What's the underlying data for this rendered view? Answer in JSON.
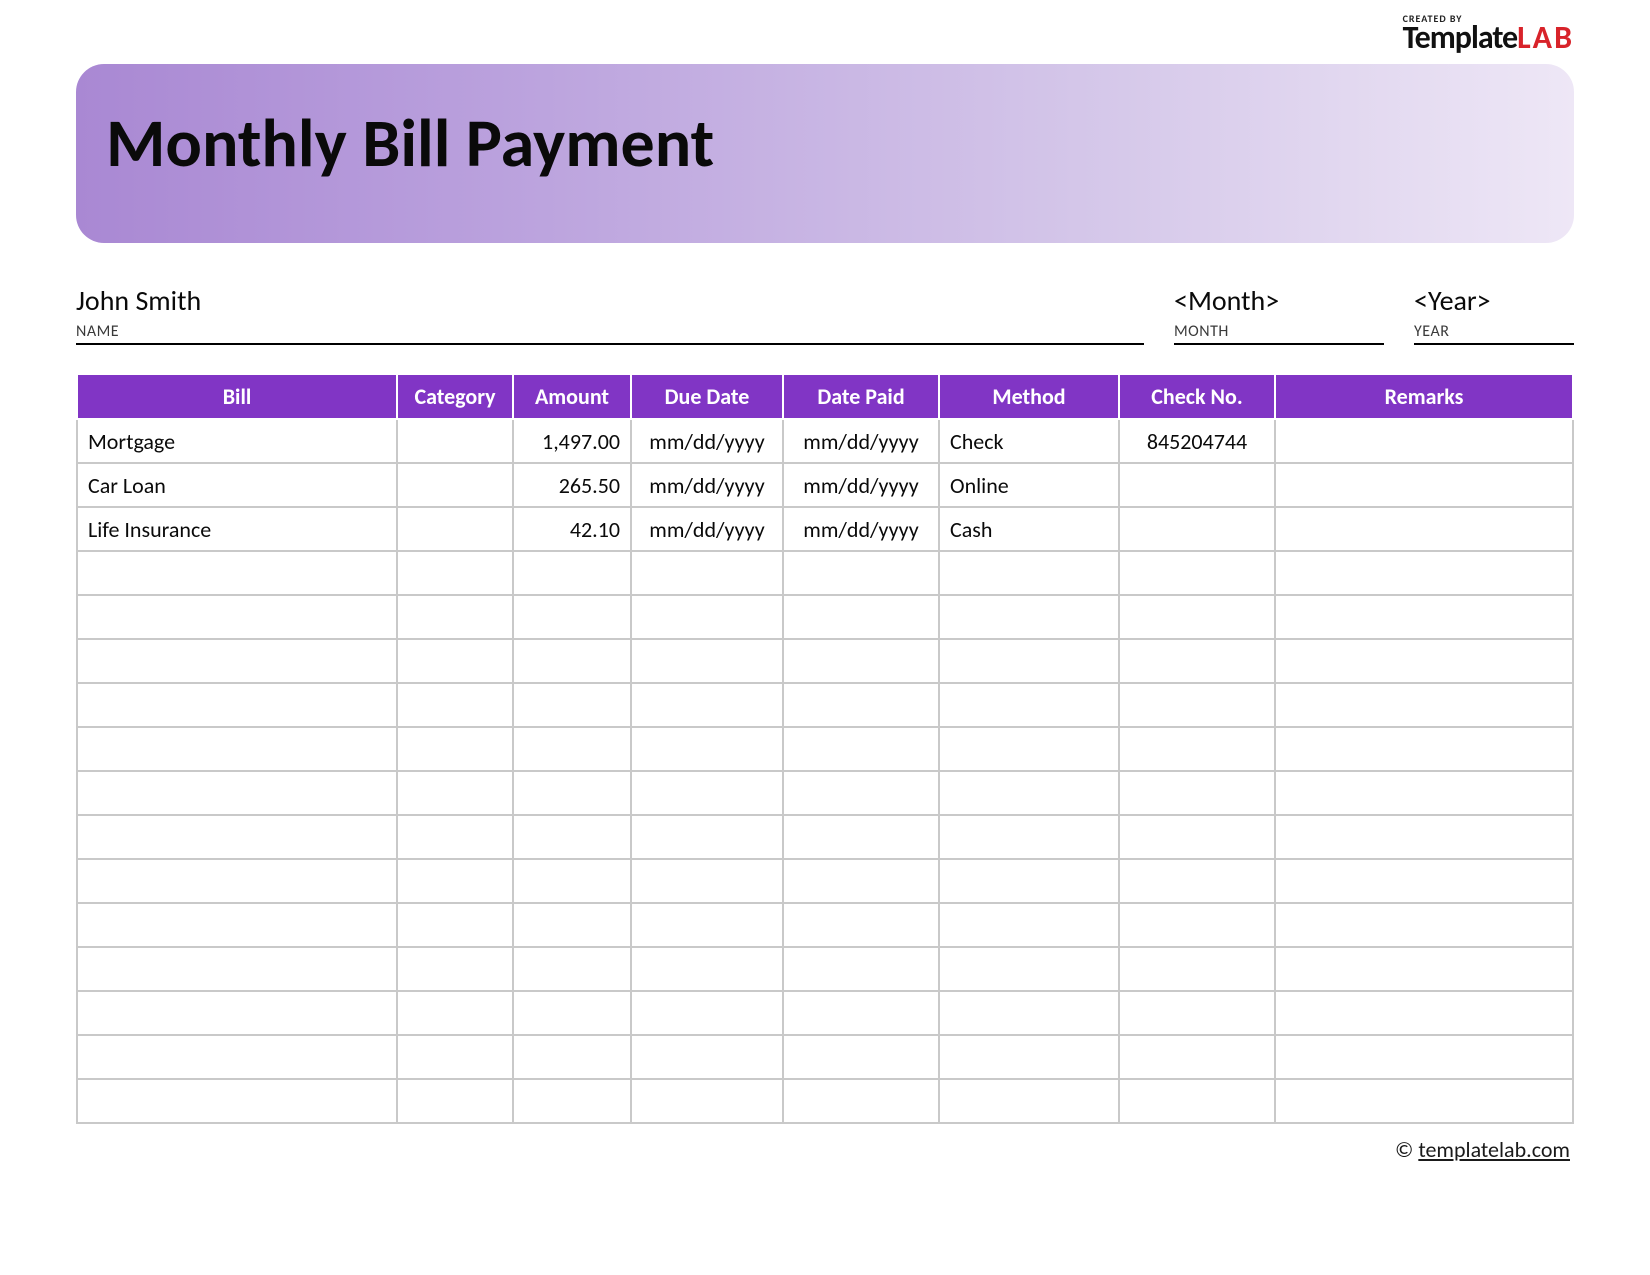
{
  "logo": {
    "created_by": "CREATED BY",
    "brand_part1": "Template",
    "brand_part2": "LAB"
  },
  "hero": {
    "title": "Monthly Bill Payment"
  },
  "meta": {
    "name_value": "John Smith",
    "name_label": "NAME",
    "month_value": "<Month>",
    "month_label": "MONTH",
    "year_value": "<Year>",
    "year_label": "YEAR"
  },
  "columns": {
    "bill": "Bill",
    "category": "Category",
    "amount": "Amount",
    "due": "Due Date",
    "paid": "Date Paid",
    "method": "Method",
    "check": "Check No.",
    "remarks": "Remarks"
  },
  "rows": [
    {
      "bill": "Mortgage",
      "category": "",
      "amount": "1,497.00",
      "due": "mm/dd/yyyy",
      "paid": "mm/dd/yyyy",
      "method": "Check",
      "check": "845204744",
      "remarks": ""
    },
    {
      "bill": "Car Loan",
      "category": "",
      "amount": "265.50",
      "due": "mm/dd/yyyy",
      "paid": "mm/dd/yyyy",
      "method": "Online",
      "check": "",
      "remarks": ""
    },
    {
      "bill": "Life Insurance",
      "category": "",
      "amount": "42.10",
      "due": "mm/dd/yyyy",
      "paid": "mm/dd/yyyy",
      "method": "Cash",
      "check": "",
      "remarks": ""
    },
    {
      "bill": "",
      "category": "",
      "amount": "",
      "due": "",
      "paid": "",
      "method": "",
      "check": "",
      "remarks": ""
    },
    {
      "bill": "",
      "category": "",
      "amount": "",
      "due": "",
      "paid": "",
      "method": "",
      "check": "",
      "remarks": ""
    },
    {
      "bill": "",
      "category": "",
      "amount": "",
      "due": "",
      "paid": "",
      "method": "",
      "check": "",
      "remarks": ""
    },
    {
      "bill": "",
      "category": "",
      "amount": "",
      "due": "",
      "paid": "",
      "method": "",
      "check": "",
      "remarks": ""
    },
    {
      "bill": "",
      "category": "",
      "amount": "",
      "due": "",
      "paid": "",
      "method": "",
      "check": "",
      "remarks": ""
    },
    {
      "bill": "",
      "category": "",
      "amount": "",
      "due": "",
      "paid": "",
      "method": "",
      "check": "",
      "remarks": ""
    },
    {
      "bill": "",
      "category": "",
      "amount": "",
      "due": "",
      "paid": "",
      "method": "",
      "check": "",
      "remarks": ""
    },
    {
      "bill": "",
      "category": "",
      "amount": "",
      "due": "",
      "paid": "",
      "method": "",
      "check": "",
      "remarks": ""
    },
    {
      "bill": "",
      "category": "",
      "amount": "",
      "due": "",
      "paid": "",
      "method": "",
      "check": "",
      "remarks": ""
    },
    {
      "bill": "",
      "category": "",
      "amount": "",
      "due": "",
      "paid": "",
      "method": "",
      "check": "",
      "remarks": ""
    },
    {
      "bill": "",
      "category": "",
      "amount": "",
      "due": "",
      "paid": "",
      "method": "",
      "check": "",
      "remarks": ""
    },
    {
      "bill": "",
      "category": "",
      "amount": "",
      "due": "",
      "paid": "",
      "method": "",
      "check": "",
      "remarks": ""
    },
    {
      "bill": "",
      "category": "",
      "amount": "",
      "due": "",
      "paid": "",
      "method": "",
      "check": "",
      "remarks": ""
    }
  ],
  "footer": {
    "copyright": "©",
    "link_text": "templatelab.com"
  }
}
